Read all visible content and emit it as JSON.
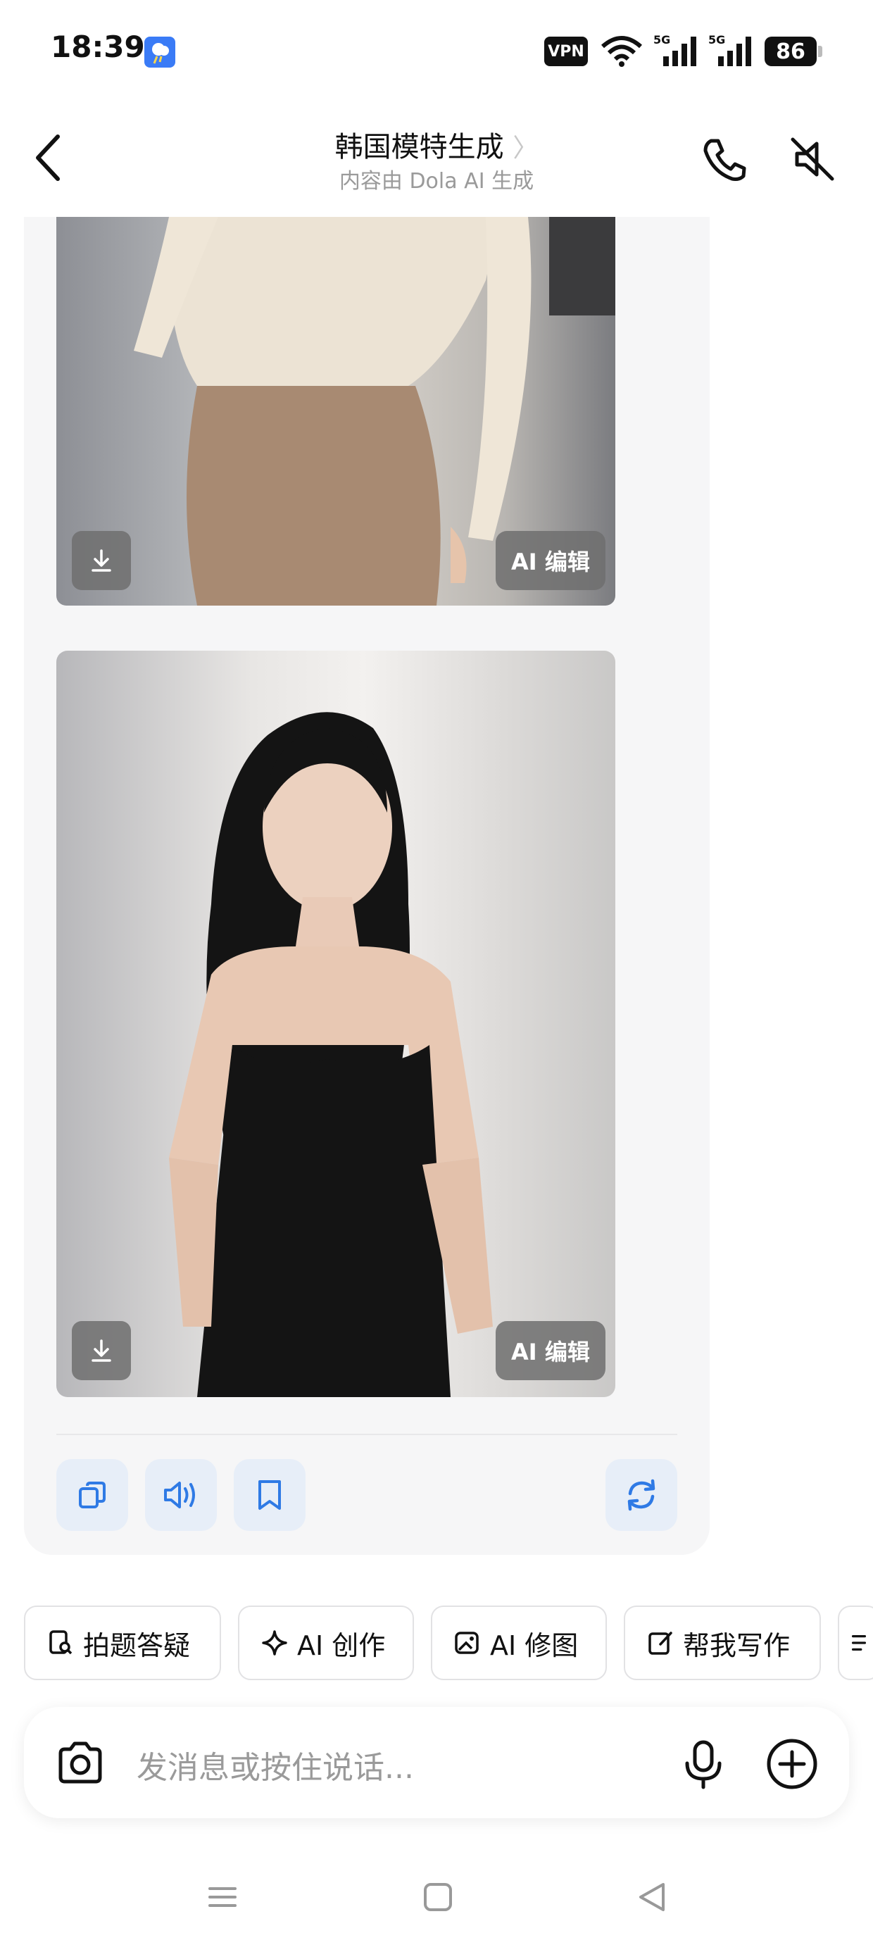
{
  "status_bar": {
    "time": "18:39",
    "vpn": "VPN",
    "signal1": "5G",
    "signal2": "5G",
    "battery": "86"
  },
  "header": {
    "title": "韩国模特生成",
    "chevron": "〉",
    "subtitle": "内容由 Dola AI 生成"
  },
  "images": [
    {
      "ai_edit_label": "AI 编辑"
    },
    {
      "ai_edit_label": "AI 编辑"
    }
  ],
  "chips": [
    {
      "label": "拍题答疑",
      "icon": "search-doc-icon"
    },
    {
      "label": "AI 创作",
      "icon": "sparkle-icon"
    },
    {
      "label": "AI 修图",
      "icon": "image-edit-icon"
    },
    {
      "label": "帮我写作",
      "icon": "edit-note-icon"
    }
  ],
  "input": {
    "placeholder": "发消息或按住说话..."
  },
  "colors": {
    "accent": "#2f7ae5",
    "panel_bg": "#f6f6f7",
    "action_bg": "#e7eef8"
  }
}
